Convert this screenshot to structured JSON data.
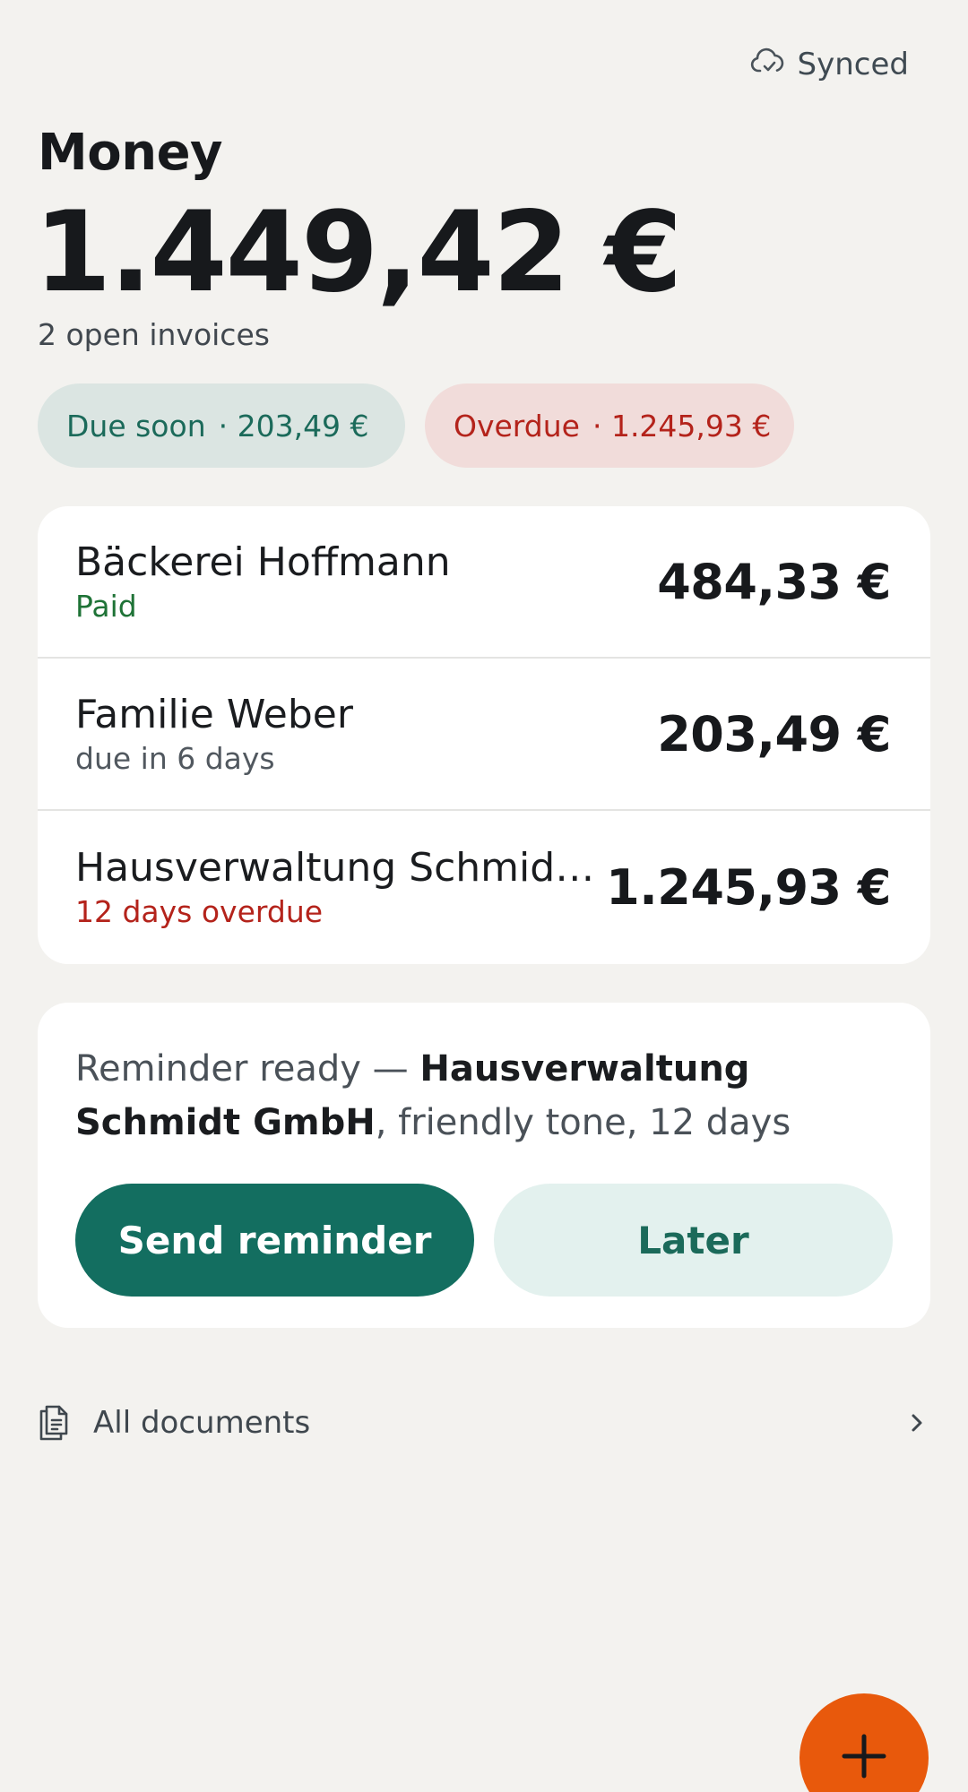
{
  "sync": {
    "label": "Synced",
    "icon": "cloud-check-icon"
  },
  "header": {
    "title": "Money",
    "balance": "1.449,42 €",
    "subtitle": "2 open invoices"
  },
  "chips": [
    {
      "label": "Due soon",
      "amount": "· 203,49 €",
      "color": "#1b6a5a"
    },
    {
      "label": "Overdue",
      "amount": "· 1.245,93 €",
      "color": "#b4231b"
    }
  ],
  "invoices": [
    {
      "name": "Bäckerei Hoffmann",
      "status": "Paid",
      "amount": "484,33 €"
    },
    {
      "name": "Familie Weber",
      "status": "due in 6 days",
      "amount": "203,49 €"
    },
    {
      "name": "Hausverwaltung Schmidt GmbH",
      "status": "12 days overdue",
      "amount": "1.245,93 €"
    }
  ],
  "reminder": {
    "prefix": "Reminder ready — ",
    "recipient": "Hausverwaltung Schmidt GmbH",
    "suffix": ", friendly tone, 12 days",
    "primary_label": "Send reminder",
    "secondary_label": "Later"
  },
  "documents": {
    "label": "All documents",
    "icon": "document-icon"
  },
  "fab": {
    "icon": "plus-icon"
  },
  "colors": {
    "accent": "#136e60",
    "danger": "#b4231b",
    "paid": "#1f7337",
    "fab": "#e8590c",
    "background": "#f3f2ef"
  }
}
